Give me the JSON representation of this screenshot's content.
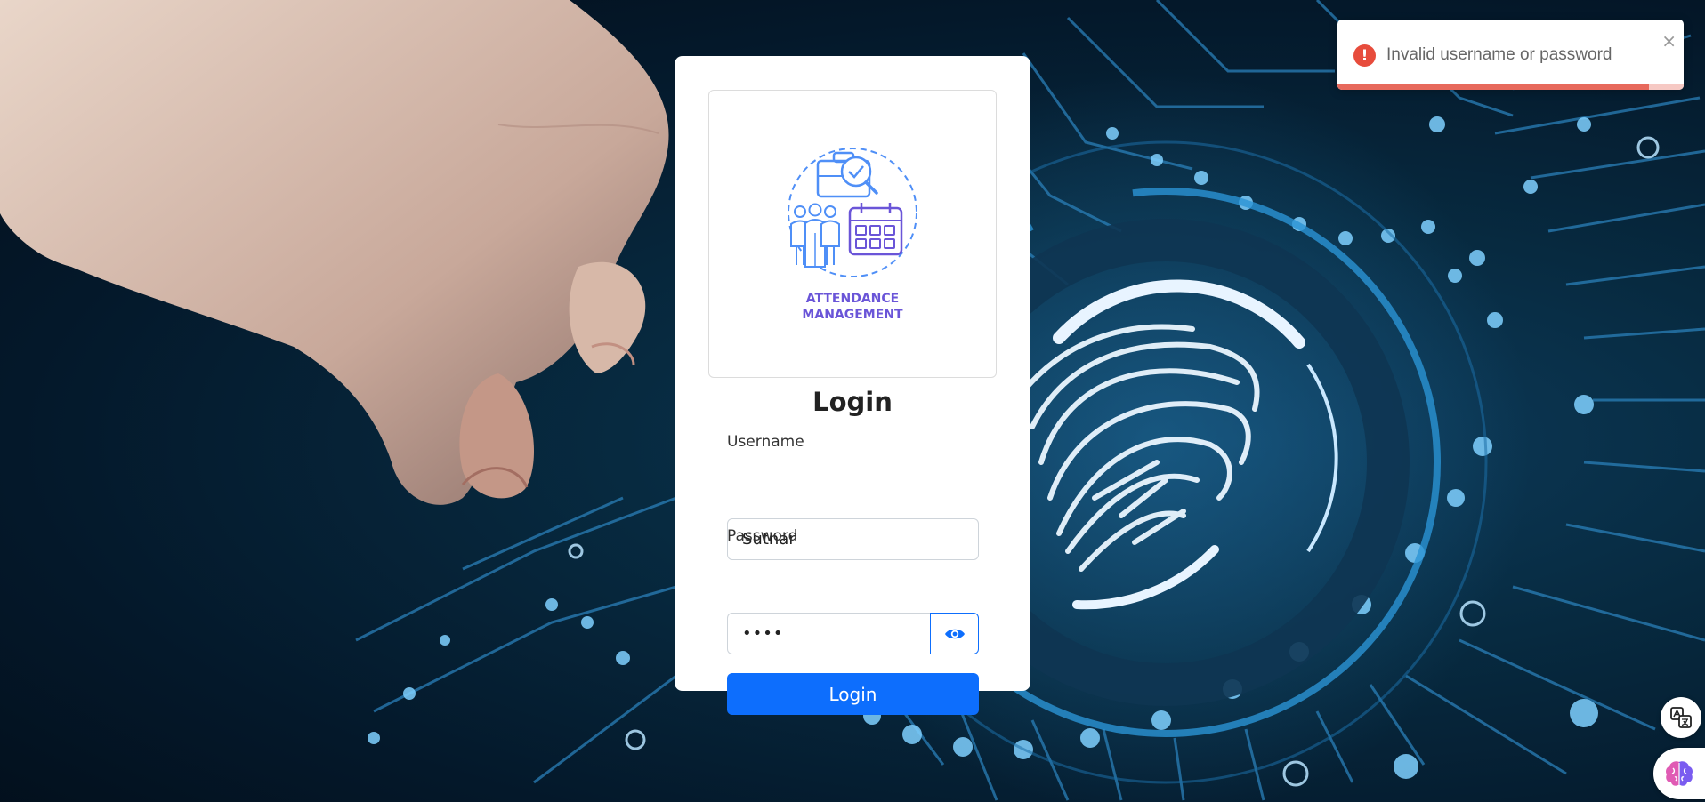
{
  "colors": {
    "primary": "#0d6efd",
    "error": "#e74c3c",
    "logo_accent": "#6a55d8",
    "logo_line": "#4f8ff7"
  },
  "logo": {
    "line1": "ATTENDANCE",
    "line2": "MANAGEMENT"
  },
  "form": {
    "title": "Login",
    "username_label": "Username",
    "username_value": "Suthar",
    "password_label": "Password",
    "password_value": "••••",
    "password_toggle_icon": "eye-icon",
    "submit_label": "Login"
  },
  "toast": {
    "icon": "error-icon",
    "message": "Invalid username or password",
    "close_label": "×",
    "progress_remaining": 0.9
  },
  "floating": {
    "translate_icon": "translate-icon",
    "assistant_icon": "brain-icon"
  }
}
